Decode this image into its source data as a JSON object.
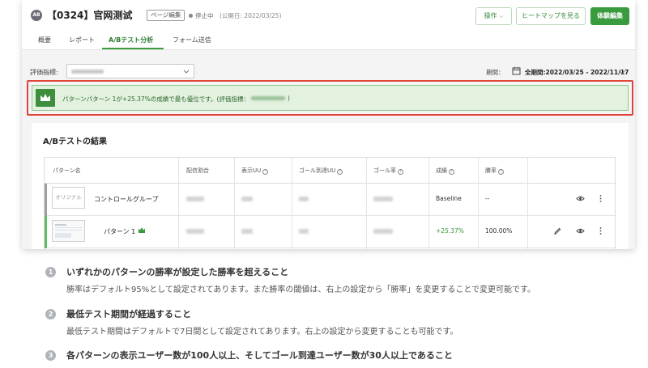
{
  "app": {
    "logo_text": "AB",
    "project_title": "【0324】官网测试",
    "edit_tag": "ページ編集",
    "status": "停止中",
    "published": "(公開日: 2022/03/25)",
    "buttons": {
      "operations": "操作",
      "heatmap": "ヒートマップを見る",
      "experience_edit": "体験編集"
    },
    "tabs": [
      "概要",
      "レポート",
      "A/Bテスト分析",
      "フォーム送信"
    ],
    "active_tab": "A/Bテスト分析"
  },
  "filters": {
    "metric_label": "評価指標:",
    "period_label": "期間：",
    "period_value": "全期間:2022/03/25 - 2022/11/17"
  },
  "banner": {
    "text": "パターンパターン 1が+25.37%の成績で最も優位です。(評価指標：",
    "tail": ")"
  },
  "results": {
    "title": "A/Bテストの結果",
    "columns": [
      "パターン名",
      "配信割合",
      "表示UU",
      "ゴール到達UU",
      "ゴール率",
      "成績",
      "勝率"
    ],
    "rows": [
      {
        "thumb_label": "オリジナル",
        "name": "コントロールグループ",
        "score": "Baseline",
        "win_rate": "--"
      },
      {
        "name": "パターン 1",
        "score": "+25.37%",
        "win_rate": "100.00%"
      }
    ]
  },
  "instructions": [
    {
      "num": "1",
      "title": "いずれかのパターンの勝率が設定した勝率を超えること",
      "desc": "勝率はデフォルト95%として設定されてあります。また勝率の閾値は、右上の設定から「勝率」を変更することで変更可能です。"
    },
    {
      "num": "2",
      "title": "最低テスト期間が経過すること",
      "desc": "最低テスト期間はデフォルトで7日間として設定されてあります。右上の設定から変更することも可能です。"
    },
    {
      "num": "3",
      "title": "各パターンの表示ユーザー数が100人以上、そしてゴール到達ユーザー数が30人以上であること",
      "desc": ""
    }
  ],
  "colors": {
    "accent_green": "#3a9a3e",
    "highlight_red": "#e0453a",
    "banner_bg": "#e3f1df"
  }
}
